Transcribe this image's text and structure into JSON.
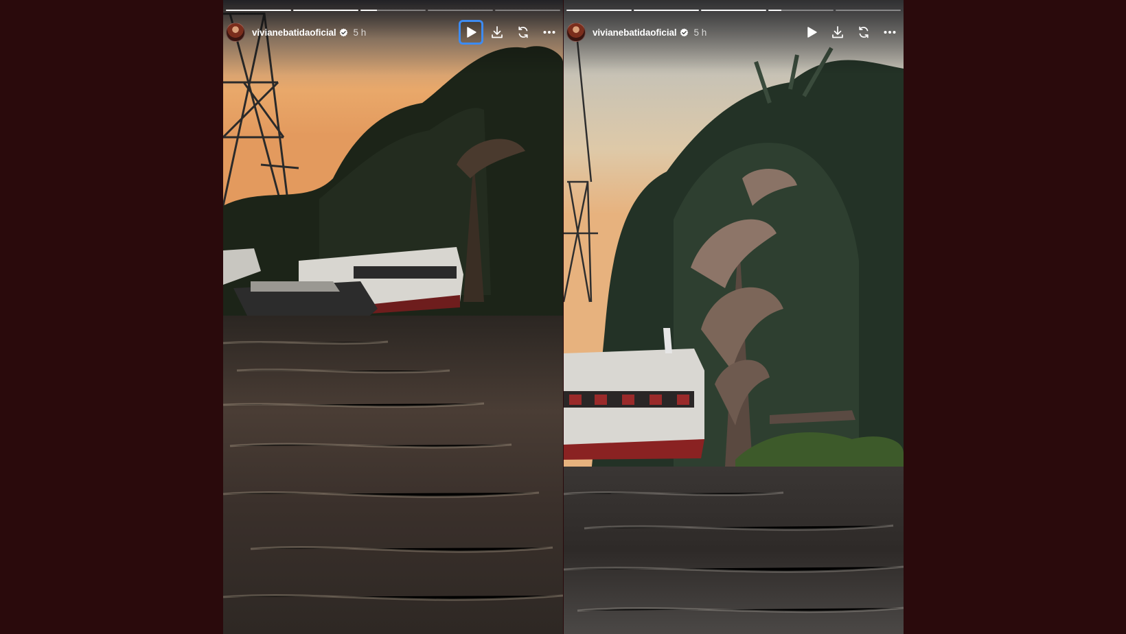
{
  "stories": [
    {
      "username": "vivianebatidaoficial",
      "time": "5 h",
      "progress_segments": [
        1,
        1,
        0.25,
        0,
        0
      ],
      "controls": [
        "play-icon",
        "download-icon",
        "replay-icon",
        "more-icon"
      ],
      "focused_control": "play-icon"
    },
    {
      "username": "vivianebatidaoficial",
      "time": "5 h",
      "progress_segments": [
        1,
        1,
        1,
        0.2,
        0
      ],
      "controls": [
        "play-icon",
        "download-icon",
        "replay-icon",
        "more-icon"
      ],
      "focused_control": null
    }
  ],
  "colors": {
    "background": "#2a0a0c",
    "focus_ring": "#3d8bf2",
    "verified_badge": "#ffffff"
  }
}
